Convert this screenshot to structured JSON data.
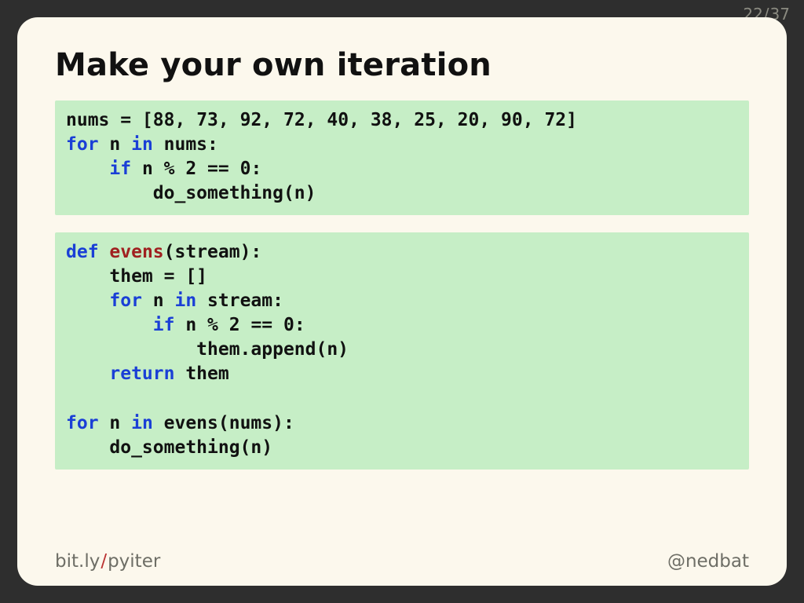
{
  "paging": {
    "current": "22",
    "separator": "/",
    "total": "37"
  },
  "title": "Make your own iteration",
  "code1": {
    "tokens": [
      {
        "t": "nums = ["
      },
      {
        "t": "88",
        "c": "num"
      },
      {
        "t": ", "
      },
      {
        "t": "73",
        "c": "num"
      },
      {
        "t": ", "
      },
      {
        "t": "92",
        "c": "num"
      },
      {
        "t": ", "
      },
      {
        "t": "72",
        "c": "num"
      },
      {
        "t": ", "
      },
      {
        "t": "40",
        "c": "num"
      },
      {
        "t": ", "
      },
      {
        "t": "38",
        "c": "num"
      },
      {
        "t": ", "
      },
      {
        "t": "25",
        "c": "num"
      },
      {
        "t": ", "
      },
      {
        "t": "20",
        "c": "num"
      },
      {
        "t": ", "
      },
      {
        "t": "90",
        "c": "num"
      },
      {
        "t": ", "
      },
      {
        "t": "72",
        "c": "num"
      },
      {
        "t": "]\n"
      },
      {
        "t": "for",
        "c": "kw"
      },
      {
        "t": " n "
      },
      {
        "t": "in",
        "c": "kw"
      },
      {
        "t": " nums:\n"
      },
      {
        "t": "    "
      },
      {
        "t": "if",
        "c": "kw"
      },
      {
        "t": " n % "
      },
      {
        "t": "2",
        "c": "num"
      },
      {
        "t": " == "
      },
      {
        "t": "0",
        "c": "num"
      },
      {
        "t": ":\n"
      },
      {
        "t": "        do_something(n)"
      }
    ]
  },
  "code2": {
    "tokens": [
      {
        "t": "def",
        "c": "kw"
      },
      {
        "t": " "
      },
      {
        "t": "evens",
        "c": "fn"
      },
      {
        "t": "(stream):\n"
      },
      {
        "t": "    them = []\n"
      },
      {
        "t": "    "
      },
      {
        "t": "for",
        "c": "kw"
      },
      {
        "t": " n "
      },
      {
        "t": "in",
        "c": "kw"
      },
      {
        "t": " stream:\n"
      },
      {
        "t": "        "
      },
      {
        "t": "if",
        "c": "kw"
      },
      {
        "t": " n % "
      },
      {
        "t": "2",
        "c": "num"
      },
      {
        "t": " == "
      },
      {
        "t": "0",
        "c": "num"
      },
      {
        "t": ":\n"
      },
      {
        "t": "            them.append(n)\n"
      },
      {
        "t": "    "
      },
      {
        "t": "return",
        "c": "kw"
      },
      {
        "t": " them\n"
      },
      {
        "t": "\n"
      },
      {
        "t": "for",
        "c": "kw"
      },
      {
        "t": " n "
      },
      {
        "t": "in",
        "c": "kw"
      },
      {
        "t": " evens(nums):\n"
      },
      {
        "t": "    do_something(n)"
      }
    ]
  },
  "footer": {
    "url_prefix": "bit.ly",
    "url_slash": "/",
    "url_path": "pyiter",
    "handle": "@nedbat"
  }
}
